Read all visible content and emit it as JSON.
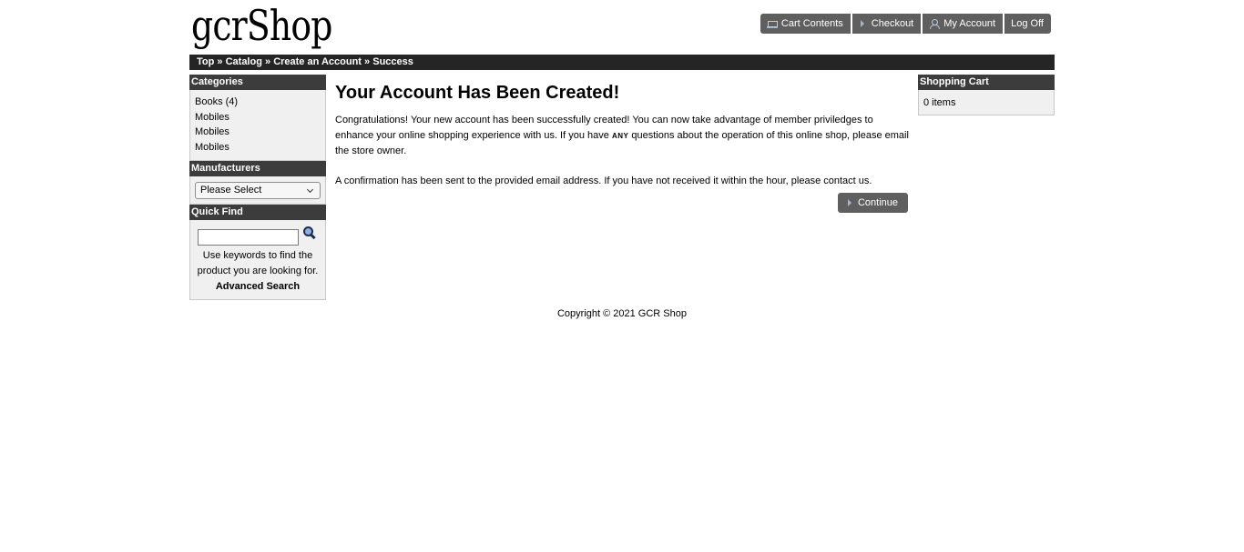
{
  "header": {
    "logo": "gcrShop",
    "nav": [
      {
        "label": "Cart Contents",
        "icon": "cart-icon"
      },
      {
        "label": "Checkout",
        "icon": "arrow-right-icon"
      },
      {
        "label": "My Account",
        "icon": "user-icon"
      },
      {
        "label": "Log Off",
        "icon": ""
      }
    ]
  },
  "breadcrumb": {
    "items": [
      "Top",
      "Catalog",
      "Create an Account",
      "Success"
    ],
    "separator": "»"
  },
  "categories": {
    "title": "Categories",
    "items": [
      "Books (4)",
      "Mobiles",
      "Mobiles",
      "Mobiles"
    ]
  },
  "manufacturers": {
    "title": "Manufacturers",
    "selected": "Please Select"
  },
  "quick_find": {
    "title": "Quick Find",
    "input_value": "",
    "help_text": "Use keywords to find the product you are looking for.",
    "advanced_link": "Advanced Search"
  },
  "main": {
    "heading": "Your Account Has Been Created!",
    "p1_before": "Congratulations! Your new account has been successfully created! You can now take advantage of member priviledges to enhance your online shopping experience with us. If you have ",
    "p1_emph": "ANY",
    "p1_after": " questions about the operation of this online shop, please email the store owner.",
    "p2": "A confirmation has been sent to the provided email address. If you have not received it within the hour, please contact us.",
    "continue_label": "Continue"
  },
  "shopping_cart": {
    "title": "Shopping Cart",
    "summary": "0 items"
  },
  "footer": {
    "copyright": "Copyright © 2021 GCR Shop"
  },
  "colors": {
    "button_bg": "#5f5f5f",
    "bar_dark": "#252525",
    "box_head": "#3c3c3c",
    "box_body": "#f0f0f0"
  }
}
